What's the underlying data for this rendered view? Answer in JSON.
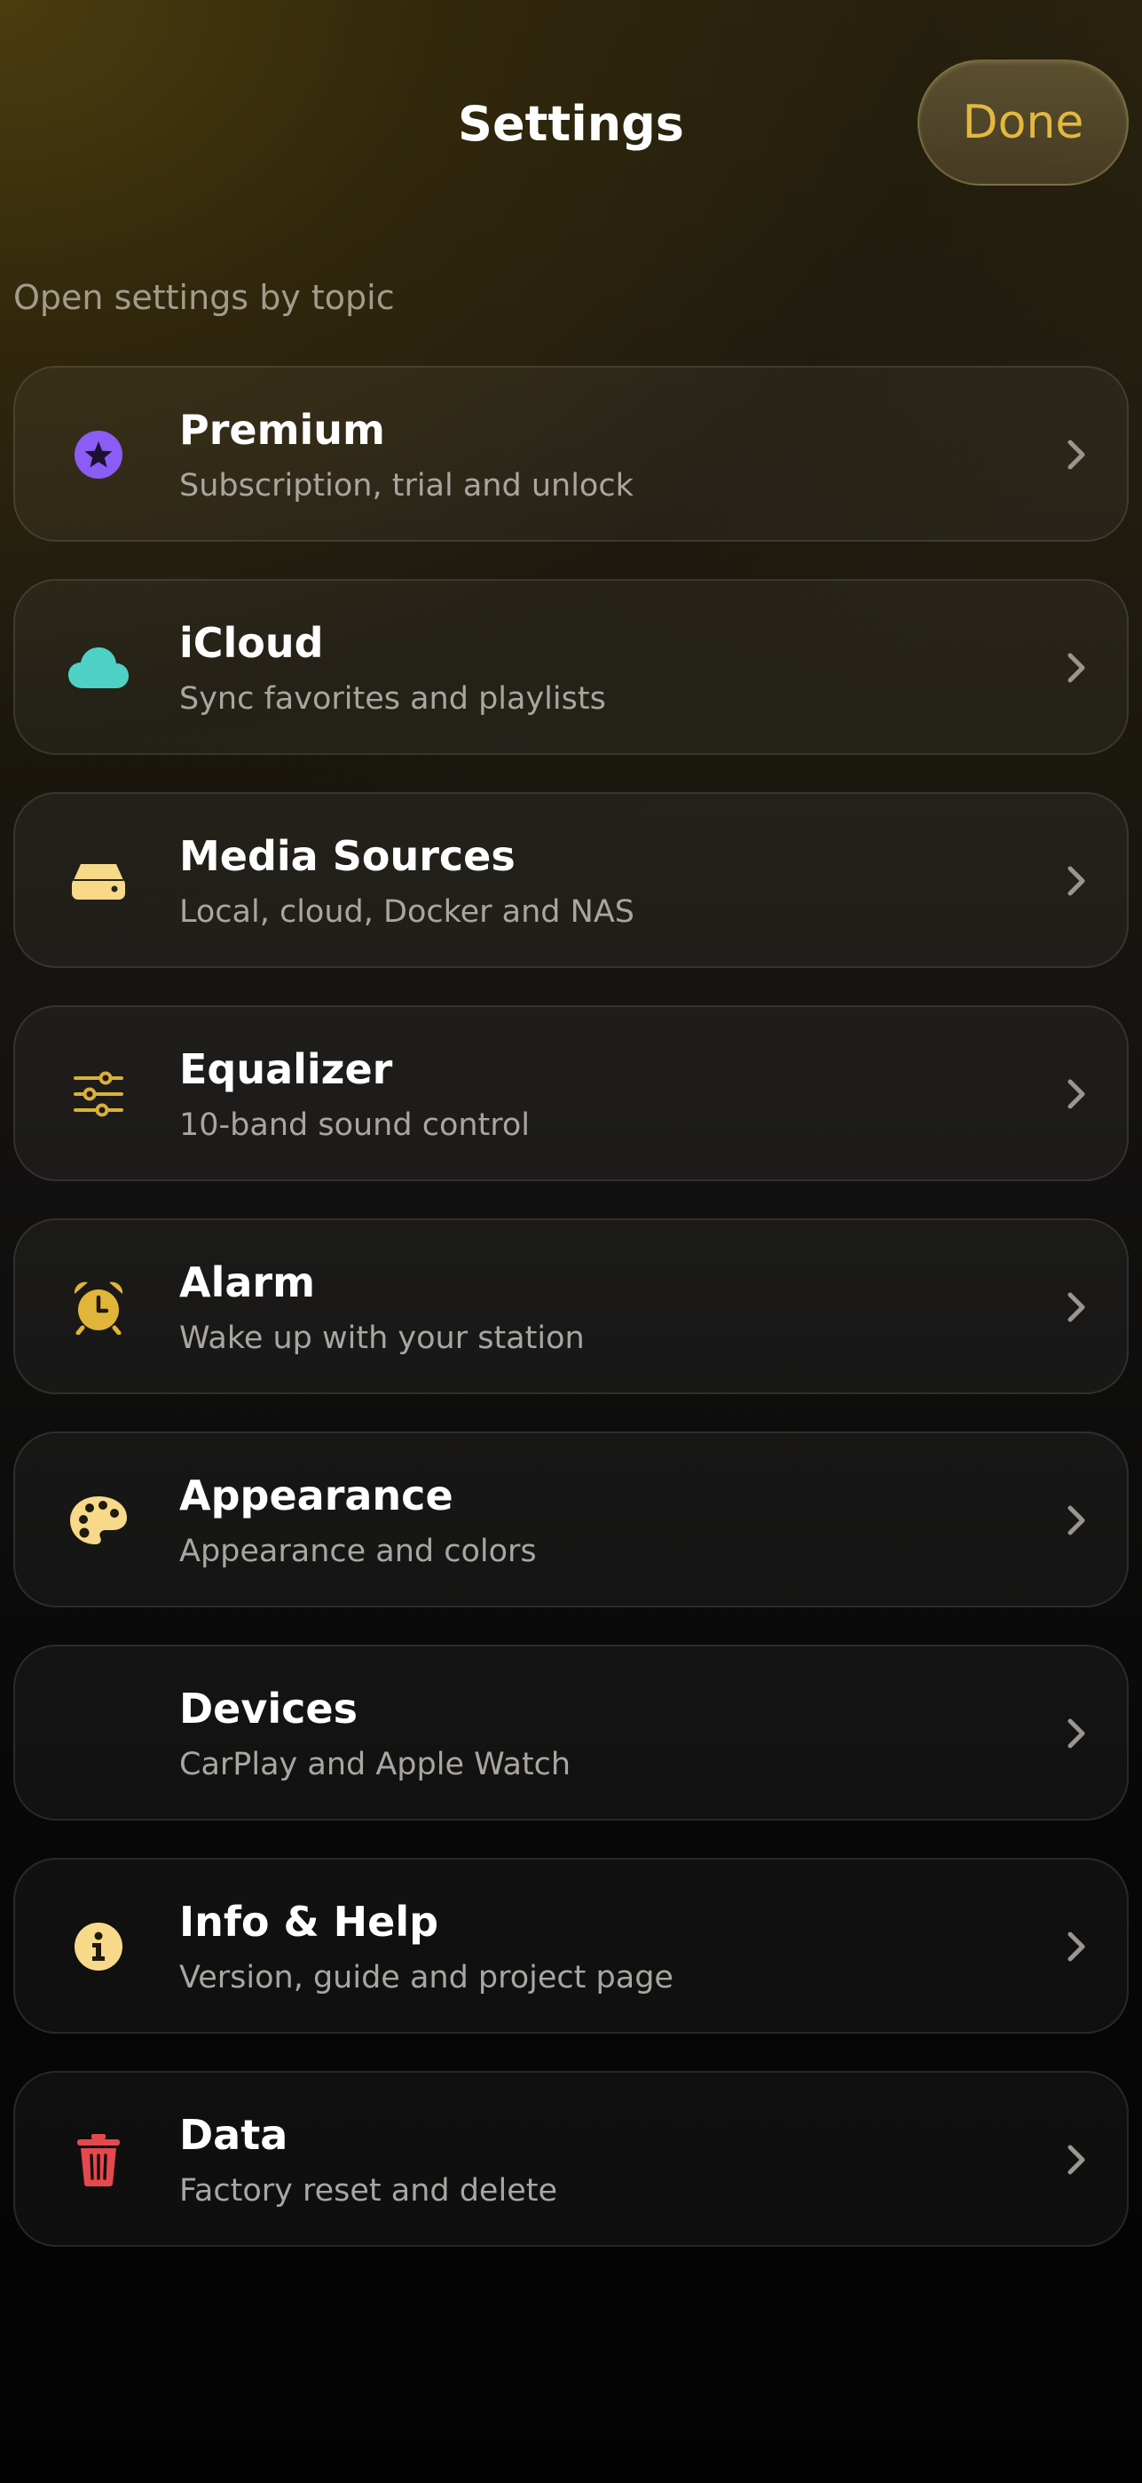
{
  "header": {
    "title": "Settings",
    "done_label": "Done"
  },
  "section_label": "Open settings by topic",
  "items": [
    {
      "label": "Premium",
      "subtitle": "Subscription, trial and unlock",
      "icon": "star-badge-icon",
      "color": "#8b5cf6"
    },
    {
      "label": "iCloud",
      "subtitle": "Sync favorites and playlists",
      "icon": "cloud-icon",
      "color": "#4fd1c5"
    },
    {
      "label": "Media Sources",
      "subtitle": "Local, cloud, Docker and NAS",
      "icon": "drive-icon",
      "color": "#f8d98a"
    },
    {
      "label": "Equalizer",
      "subtitle": "10-band sound control",
      "icon": "sliders-icon",
      "color": "#d8b13a"
    },
    {
      "label": "Alarm",
      "subtitle": "Wake up with your station",
      "icon": "alarm-clock-icon",
      "color": "#e0b53a"
    },
    {
      "label": "Appearance",
      "subtitle": "Appearance and colors",
      "icon": "palette-icon",
      "color": "#f8d98a"
    },
    {
      "label": "Devices",
      "subtitle": "CarPlay and Apple Watch",
      "icon": "",
      "color": ""
    },
    {
      "label": "Info & Help",
      "subtitle": "Version, guide and project page",
      "icon": "info-icon",
      "color": "#f8d98a"
    },
    {
      "label": "Data",
      "subtitle": "Factory reset and delete",
      "icon": "trash-icon",
      "color": "#e5484d"
    }
  ]
}
